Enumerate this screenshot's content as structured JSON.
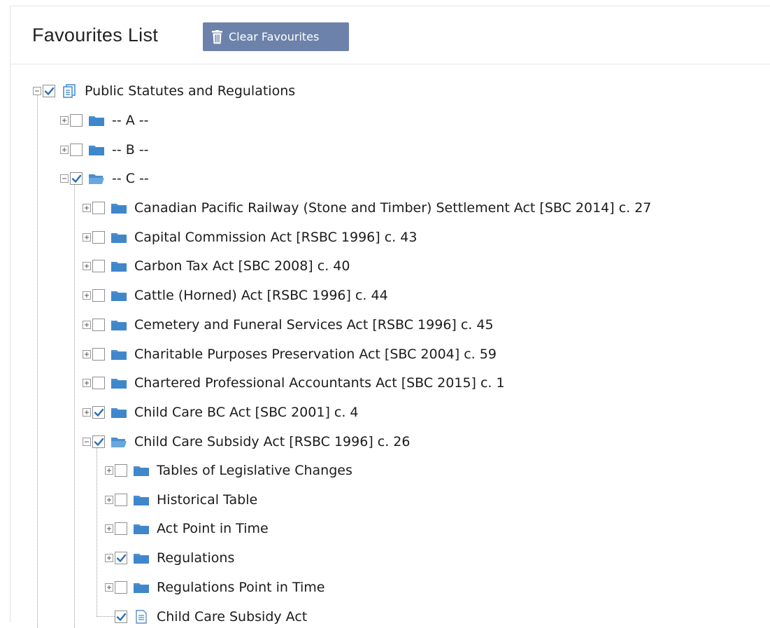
{
  "header": {
    "title": "Favourites List",
    "clear_button": "Clear Favourites"
  },
  "colors": {
    "button_bg": "#6d82aa",
    "folder": "#4a8fd0",
    "checkbox_check": "#2a6fb5"
  },
  "tree": {
    "root": {
      "label": "Public Statutes and Regulations",
      "checked": true,
      "expanded": true,
      "icon": "stack-icon"
    },
    "groups": [
      {
        "label": "-- A --",
        "checked": false,
        "expanded": false,
        "icon": "folder-icon"
      },
      {
        "label": "-- B --",
        "checked": false,
        "expanded": false,
        "icon": "folder-icon"
      },
      {
        "label": "-- C --",
        "checked": true,
        "expanded": true,
        "icon": "folder-open-icon"
      }
    ],
    "acts": [
      {
        "label": "Canadian Pacific Railway (Stone and Timber) Settlement Act [SBC 2014] c. 27",
        "checked": false,
        "expanded": false
      },
      {
        "label": "Capital Commission Act [RSBC 1996] c. 43",
        "checked": false,
        "expanded": false
      },
      {
        "label": "Carbon Tax Act [SBC 2008] c. 40",
        "checked": false,
        "expanded": false
      },
      {
        "label": "Cattle (Horned) Act [RSBC 1996] c. 44",
        "checked": false,
        "expanded": false
      },
      {
        "label": "Cemetery and Funeral Services Act [RSBC 1996] c. 45",
        "checked": false,
        "expanded": false
      },
      {
        "label": "Charitable Purposes Preservation Act [SBC 2004] c. 59",
        "checked": false,
        "expanded": false
      },
      {
        "label": "Chartered Professional Accountants Act [SBC 2015] c. 1",
        "checked": false,
        "expanded": false
      },
      {
        "label": "Child Care BC Act [SBC 2001] c. 4",
        "checked": true,
        "expanded": false
      },
      {
        "label": "Child Care Subsidy Act [RSBC 1996] c. 26",
        "checked": true,
        "expanded": true
      }
    ],
    "children": [
      {
        "label": "Tables of Legislative Changes",
        "checked": false,
        "icon": "folder-icon"
      },
      {
        "label": "Historical Table",
        "checked": false,
        "icon": "folder-icon"
      },
      {
        "label": "Act Point in Time",
        "checked": false,
        "icon": "folder-icon"
      },
      {
        "label": "Regulations",
        "checked": true,
        "icon": "folder-icon"
      },
      {
        "label": "Regulations Point in Time",
        "checked": false,
        "icon": "folder-icon"
      },
      {
        "label": "Child Care Subsidy Act",
        "checked": true,
        "icon": "document-icon"
      }
    ]
  }
}
